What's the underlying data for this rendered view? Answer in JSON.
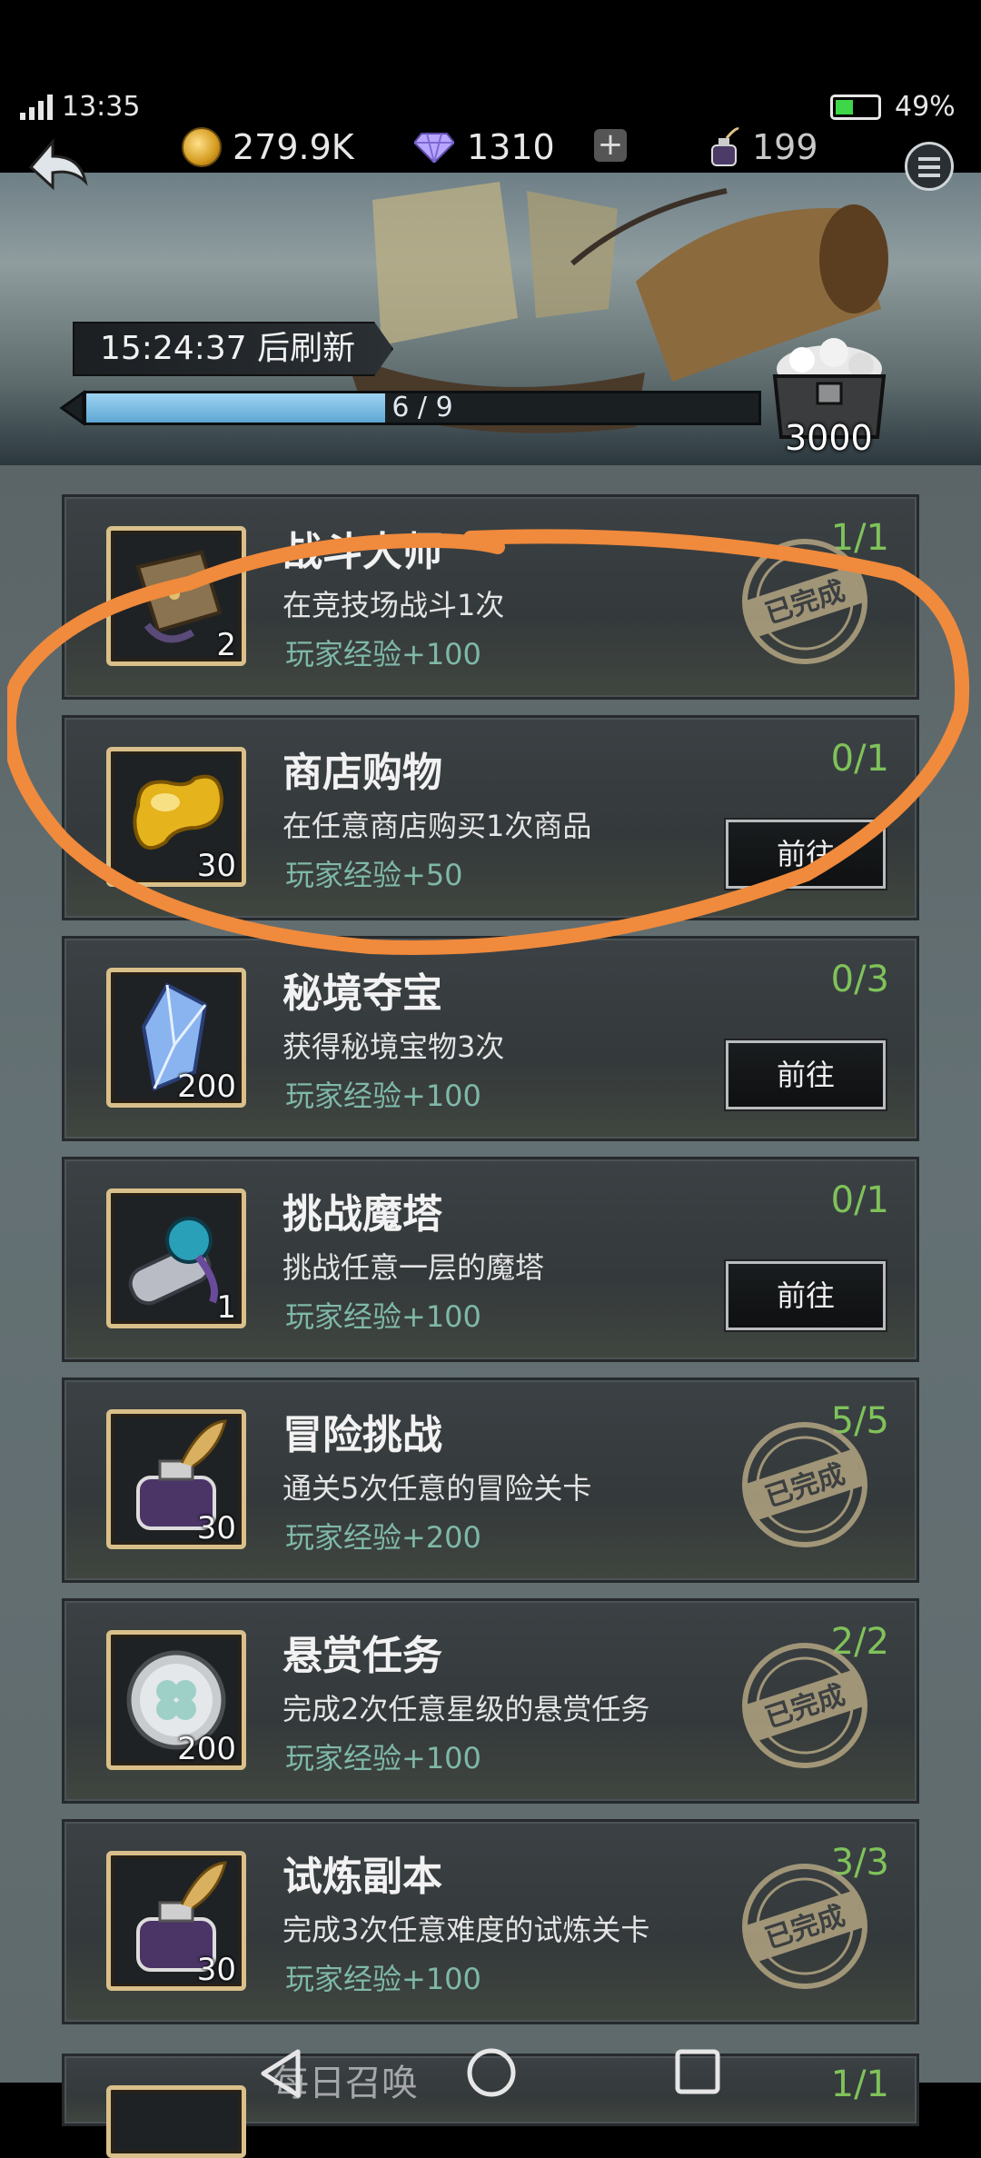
{
  "status_bar": {
    "time": "13:35",
    "battery": "49%",
    "battery_level": 0.49
  },
  "resources": {
    "gold": "279.9K",
    "gems": "1310",
    "ink": "199"
  },
  "banner": {
    "refresh_text": "15:24:37 后刷新",
    "progress_text": "6 / 9",
    "progress_fraction": 0.4444,
    "chest_value": "3000"
  },
  "tasks": [
    {
      "title": "战斗大师",
      "desc": "在竞技场战斗1次",
      "reward": "玩家经验+100",
      "progress": "1/1",
      "icon": "scroll-map-icon",
      "count": "2",
      "state": "completed",
      "stamp": "已完成"
    },
    {
      "title": "商店购物",
      "desc": "在任意商店购买1次商品",
      "reward": "玩家经验+50",
      "progress": "0/1",
      "icon": "gold-bean-icon",
      "count": "30",
      "state": "go",
      "button": "前往"
    },
    {
      "title": "秘境夺宝",
      "desc": "获得秘境宝物3次",
      "reward": "玩家经验+100",
      "progress": "0/3",
      "icon": "crystal-icon",
      "count": "200",
      "state": "go",
      "button": "前往"
    },
    {
      "title": "挑战魔塔",
      "desc": "挑战任意一层的魔塔",
      "reward": "玩家经验+100",
      "progress": "0/1",
      "icon": "sealed-scroll-icon",
      "count": "1",
      "state": "go",
      "button": "前往"
    },
    {
      "title": "冒险挑战",
      "desc": "通关5次任意的冒险关卡",
      "reward": "玩家经验+200",
      "progress": "5/5",
      "icon": "ink-bottle-icon",
      "count": "30",
      "state": "completed",
      "stamp": "已完成"
    },
    {
      "title": "悬赏任务",
      "desc": "完成2次任意星级的悬赏任务",
      "reward": "玩家经验+100",
      "progress": "2/2",
      "icon": "clover-coin-icon",
      "count": "200",
      "state": "completed",
      "stamp": "已完成"
    },
    {
      "title": "试炼副本",
      "desc": "完成3次任意难度的试炼关卡",
      "reward": "玩家经验+100",
      "progress": "3/3",
      "icon": "ink-bottle-icon",
      "count": "30",
      "state": "completed",
      "stamp": "已完成"
    }
  ],
  "partial_task": {
    "title": "每日召唤",
    "progress": "1/1"
  },
  "colors": {
    "accent_green": "#7fc25a",
    "reward_teal": "#7fb8a8",
    "highlight_circle": "#f08a3c"
  }
}
